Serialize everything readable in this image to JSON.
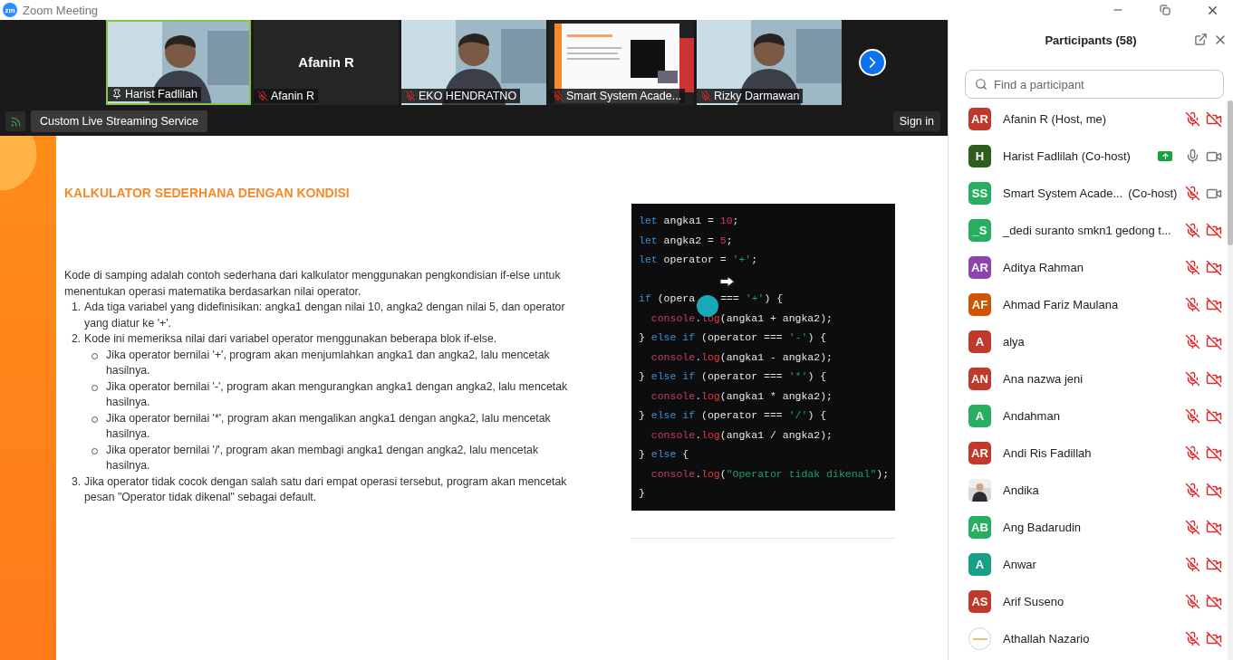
{
  "window": {
    "logo": "zm",
    "title": "Zoom Meeting"
  },
  "video_strip": {
    "tiles": [
      {
        "kind": "video",
        "name": "Harist Fadlilah",
        "pinned": true,
        "muted": false,
        "speaking": true
      },
      {
        "kind": "name_only",
        "display": "Afanin R",
        "name": "Afanin R",
        "pinned": false,
        "muted": true,
        "speaking": false
      },
      {
        "kind": "video",
        "name": "EKO HENDRATNO",
        "pinned": false,
        "muted": true,
        "speaking": false
      },
      {
        "kind": "screen",
        "name": "Smart System Acade...",
        "pinned": false,
        "muted": true,
        "speaking": false
      },
      {
        "kind": "video",
        "name": "Rizky Darmawan",
        "pinned": false,
        "muted": true,
        "speaking": false
      }
    ]
  },
  "toolbar": {
    "streaming_label": "Custom Live Streaming Service",
    "sign_in": "Sign in"
  },
  "slide": {
    "heading": "KALKULATOR SEDERHANA DENGAN KONDISI",
    "intro": "Kode di samping adalah contoh sederhana dari kalkulator menggunakan pengkondisian if-else untuk menentukan operasi matematika berdasarkan nilai operator.",
    "steps": [
      {
        "number": "1.",
        "text": "Ada tiga variabel yang didefinisikan: angka1 dengan nilai 10, angka2 dengan nilai 5, dan operator yang diatur ke '+'."
      },
      {
        "number": "2.",
        "text": "Kode ini memeriksa nilai dari variabel operator menggunakan beberapa blok if-else.",
        "children": [
          "Jika operator bernilai '+', program akan menjumlahkan angka1 dan angka2, lalu mencetak hasilnya.",
          "Jika operator bernilai '-', program akan mengurangkan angka1 dengan angka2, lalu mencetak hasilnya.",
          "Jika operator bernilai '*', program akan mengalikan angka1 dengan angka2, lalu mencetak hasilnya.",
          "Jika operator bernilai '/', program akan membagi angka1 dengan angka2, lalu mencetak hasilnya."
        ]
      },
      {
        "number": "3.",
        "text": "Jika operator tidak cocok dengan salah satu dari empat operasi tersebut, program akan mencetak pesan \"Operator tidak dikenal\" sebagai default."
      }
    ],
    "code_lines": [
      {
        "kind": "code",
        "tokens": [
          {
            "t": "let",
            "kind": "keyword"
          },
          {
            "t": " angka1 = ",
            "kind": "plain"
          },
          {
            "t": "10",
            "kind": "number"
          },
          {
            "t": ";",
            "kind": "plain"
          }
        ]
      },
      {
        "kind": "code",
        "tokens": [
          {
            "t": "let",
            "kind": "keyword"
          },
          {
            "t": " angka2 = ",
            "kind": "plain"
          },
          {
            "t": "5",
            "kind": "number"
          },
          {
            "t": ";",
            "kind": "plain"
          }
        ]
      },
      {
        "kind": "code",
        "tokens": [
          {
            "t": "let",
            "kind": "keyword"
          },
          {
            "t": " operator = ",
            "kind": "plain"
          },
          {
            "t": "'+'",
            "kind": "string"
          },
          {
            "t": ";",
            "kind": "plain"
          }
        ]
      },
      {
        "kind": "blank"
      },
      {
        "kind": "code",
        "tokens": [
          {
            "t": "if",
            "kind": "keyword"
          },
          {
            "t": " (opera",
            "kind": "plain"
          },
          {
            "kind": "cursor"
          },
          {
            "t": "=== ",
            "kind": "plain"
          },
          {
            "t": "'+'",
            "kind": "string"
          },
          {
            "t": ") {",
            "kind": "plain"
          }
        ]
      },
      {
        "kind": "code",
        "tokens": [
          {
            "t": "  console",
            "kind": "object"
          },
          {
            "t": ".",
            "kind": "plain"
          },
          {
            "t": "log",
            "kind": "method"
          },
          {
            "t": "(angka1 + angka2);",
            "kind": "plain"
          }
        ]
      },
      {
        "kind": "code",
        "tokens": [
          {
            "t": "} ",
            "kind": "plain"
          },
          {
            "t": "else if",
            "kind": "keyword"
          },
          {
            "t": " (operator === ",
            "kind": "plain"
          },
          {
            "t": "'-'",
            "kind": "string"
          },
          {
            "t": ") {",
            "kind": "plain"
          }
        ]
      },
      {
        "kind": "code",
        "tokens": [
          {
            "t": "  console",
            "kind": "object"
          },
          {
            "t": ".",
            "kind": "plain"
          },
          {
            "t": "log",
            "kind": "method"
          },
          {
            "t": "(angka1 - angka2);",
            "kind": "plain"
          }
        ]
      },
      {
        "kind": "code",
        "tokens": [
          {
            "t": "} ",
            "kind": "plain"
          },
          {
            "t": "else if",
            "kind": "keyword"
          },
          {
            "t": " (operator === ",
            "kind": "plain"
          },
          {
            "t": "'*'",
            "kind": "string"
          },
          {
            "t": ") {",
            "kind": "plain"
          }
        ]
      },
      {
        "kind": "code",
        "tokens": [
          {
            "t": "  console",
            "kind": "object"
          },
          {
            "t": ".",
            "kind": "plain"
          },
          {
            "t": "log",
            "kind": "method"
          },
          {
            "t": "(angka1 * angka2);",
            "kind": "plain"
          }
        ]
      },
      {
        "kind": "code",
        "tokens": [
          {
            "t": "} ",
            "kind": "plain"
          },
          {
            "t": "else if",
            "kind": "keyword"
          },
          {
            "t": " (operator === ",
            "kind": "plain"
          },
          {
            "t": "'/'",
            "kind": "string"
          },
          {
            "t": ") {",
            "kind": "plain"
          }
        ]
      },
      {
        "kind": "code",
        "tokens": [
          {
            "t": "  console",
            "kind": "object"
          },
          {
            "t": ".",
            "kind": "plain"
          },
          {
            "t": "log",
            "kind": "method"
          },
          {
            "t": "(angka1 / angka2);",
            "kind": "plain"
          }
        ]
      },
      {
        "kind": "code",
        "tokens": [
          {
            "t": "} ",
            "kind": "plain"
          },
          {
            "t": "else",
            "kind": "keyword"
          },
          {
            "t": " {",
            "kind": "plain"
          }
        ]
      },
      {
        "kind": "code",
        "tokens": [
          {
            "t": "  console",
            "kind": "object"
          },
          {
            "t": ".",
            "kind": "plain"
          },
          {
            "t": "log",
            "kind": "method"
          },
          {
            "t": "(",
            "kind": "plain"
          },
          {
            "t": "\"Operator tidak dikenal\"",
            "kind": "string"
          },
          {
            "t": ");",
            "kind": "plain"
          }
        ]
      },
      {
        "kind": "code",
        "tokens": [
          {
            "t": "}",
            "kind": "plain"
          }
        ]
      }
    ]
  },
  "participants": {
    "title": "Participants (58)",
    "search": {
      "placeholder": "Find a participant"
    },
    "items": [
      {
        "kind": "initials",
        "initials": "AR",
        "color": "#c0392b",
        "name": "Afanin R (Host, me)",
        "muted": true,
        "video_off": true,
        "sharing": false
      },
      {
        "kind": "initials",
        "initials": "H",
        "color": "#2e5e1e",
        "name": "Harist Fadlilah (Co-host)",
        "muted": false,
        "video_off": false,
        "sharing": true
      },
      {
        "kind": "initials",
        "initials": "SS",
        "color": "#27ae60",
        "name": "Smart System Acade...",
        "role": "(Co-host)",
        "muted": true,
        "video_off": false,
        "sharing": false
      },
      {
        "kind": "initials",
        "initials": "_S",
        "color": "#27ae60",
        "name": "_dedi suranto smkn1 gedong t...",
        "muted": true,
        "video_off": true,
        "sharing": false
      },
      {
        "kind": "initials",
        "initials": "AR",
        "color": "#8e44ad",
        "name": "Aditya Rahman",
        "muted": true,
        "video_off": true,
        "sharing": false
      },
      {
        "kind": "initials",
        "initials": "AF",
        "color": "#d35400",
        "name": "Ahmad Fariz Maulana",
        "muted": true,
        "video_off": true,
        "sharing": false
      },
      {
        "kind": "initials",
        "initials": "A",
        "color": "#c0392b",
        "name": "alya",
        "muted": true,
        "video_off": true,
        "sharing": false
      },
      {
        "kind": "initials",
        "initials": "AN",
        "color": "#c0392b",
        "name": "Ana nazwa jeni",
        "muted": true,
        "video_off": true,
        "sharing": false
      },
      {
        "kind": "initials",
        "initials": "A",
        "color": "#27ae60",
        "name": "Andahman",
        "muted": true,
        "video_off": true,
        "sharing": false
      },
      {
        "kind": "initials",
        "initials": "AR",
        "color": "#c0392b",
        "name": "Andi Ris Fadillah",
        "muted": true,
        "video_off": true,
        "sharing": false
      },
      {
        "name": "Andika",
        "muted": true,
        "video_off": true,
        "sharing": false
      },
      {
        "kind": "initials",
        "initials": "AB",
        "color": "#27ae60",
        "name": "Ang Badarudin",
        "muted": true,
        "video_off": true,
        "sharing": false
      },
      {
        "kind": "initials",
        "initials": "A",
        "color": "#16a085",
        "name": "Anwar",
        "muted": true,
        "video_off": true,
        "sharing": false
      },
      {
        "kind": "initials",
        "initials": "AS",
        "color": "#c0392b",
        "name": "Arif Suseno",
        "muted": true,
        "video_off": true,
        "sharing": false
      },
      {
        "kind": "logo",
        "name": "Athallah Nazario",
        "muted": true,
        "video_off": true,
        "sharing": false
      }
    ]
  }
}
